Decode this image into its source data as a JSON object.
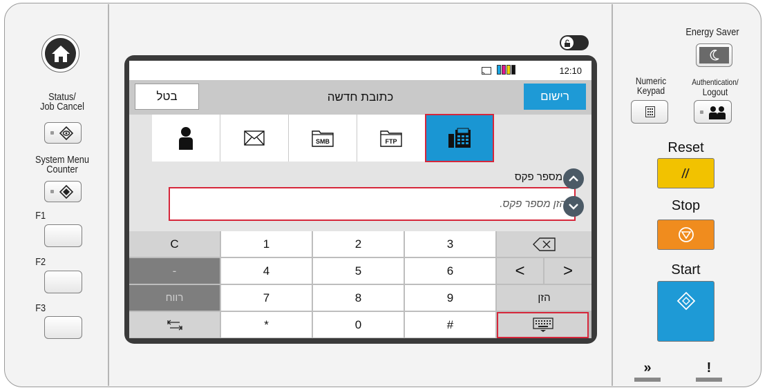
{
  "left_panel": {
    "status_label_line1": "Status/",
    "status_label_line2": "Job Cancel",
    "system_menu_label_line1": "System Menu",
    "system_menu_label_line2": "Counter",
    "f1_label": "F1",
    "f2_label": "F2",
    "f3_label": "F3"
  },
  "screen": {
    "clock": "12:10",
    "title": "כתובת חדשה",
    "cancel_label": "בטל",
    "register_label": "רישום",
    "tabs": [
      {
        "name": "user",
        "icon": "person-icon",
        "active": false
      },
      {
        "name": "email",
        "icon": "envelope-icon",
        "active": false
      },
      {
        "name": "smb",
        "icon": "smb-folder-icon",
        "label": "SMB",
        "active": false
      },
      {
        "name": "ftp",
        "icon": "ftp-folder-icon",
        "label": "FTP",
        "active": false
      },
      {
        "name": "fax",
        "icon": "fax-icon",
        "active": true
      }
    ],
    "field_label": "מספר פקס",
    "field_placeholder": "הזן מספר פקס.",
    "keypad": {
      "clear": "C",
      "hyphen": "-",
      "space": "רווח",
      "enter": "הזן",
      "digits": [
        "1",
        "2",
        "3",
        "4",
        "5",
        "6",
        "7",
        "8",
        "9",
        "*",
        "0",
        "#"
      ],
      "left_arrow": "<",
      "right_arrow": ">"
    }
  },
  "right_panel": {
    "energy_saver_label": "Energy Saver",
    "numeric_keypad_label_line1": "Numeric",
    "numeric_keypad_label_line2": "Keypad",
    "auth_label_line1": "Authentication/",
    "auth_label_line2": "Logout",
    "reset_label": "Reset",
    "stop_label": "Stop",
    "start_label": "Start",
    "indicator_data": "»",
    "indicator_attention": "!",
    "colors": {
      "reset": "#f2c200",
      "stop": "#f08c1e",
      "start": "#1e9ad6"
    }
  }
}
